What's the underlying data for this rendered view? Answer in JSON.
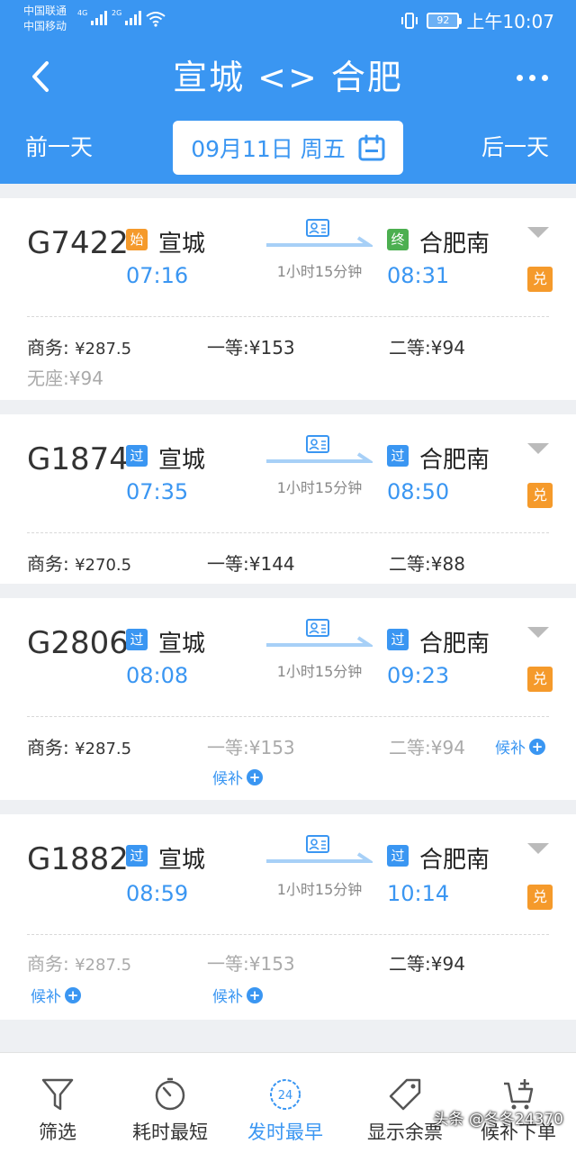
{
  "status_bar": {
    "carrier1": "中国联通",
    "carrier2": "中国移动",
    "net1": "4G",
    "net2": "2G",
    "battery": "92",
    "time": "上午10:07"
  },
  "header": {
    "title": "宣城 <> 合肥",
    "prev_day": "前一天",
    "next_day": "后一天",
    "date": "09月11日 周五",
    "bg_color": "#3a96f2"
  },
  "trains": [
    {
      "number": "G7422",
      "from_tag": "始",
      "from_station": "宣城",
      "depart": "07:16",
      "duration": "1小时15分钟",
      "to_tag": "终",
      "to_station": "合肥南",
      "arrive": "08:31",
      "exchange": "兑",
      "prices": {
        "business_label": "商务:",
        "business": "¥287.5",
        "first_label": "一等:",
        "first": "¥153",
        "second_label": "二等:",
        "second": "¥94",
        "noseat_label": "无座:",
        "noseat": "¥94"
      }
    },
    {
      "number": "G1874",
      "from_tag": "过",
      "from_station": "宣城",
      "depart": "07:35",
      "duration": "1小时15分钟",
      "to_tag": "过",
      "to_station": "合肥南",
      "arrive": "08:50",
      "exchange": "兑",
      "prices": {
        "business_label": "商务:",
        "business": "¥270.5",
        "first_label": "一等:",
        "first": "¥144",
        "second_label": "二等:",
        "second": "¥88"
      }
    },
    {
      "number": "G2806",
      "from_tag": "过",
      "from_station": "宣城",
      "depart": "08:08",
      "duration": "1小时15分钟",
      "to_tag": "过",
      "to_station": "合肥南",
      "arrive": "09:23",
      "exchange": "兑",
      "prices": {
        "business_label": "商务:",
        "business": "¥287.5",
        "first_label": "一等:",
        "first": "¥153",
        "second_label": "二等:",
        "second": "¥94"
      },
      "waitlist": "候补"
    },
    {
      "number": "G1882",
      "from_tag": "过",
      "from_station": "宣城",
      "depart": "08:59",
      "duration": "1小时15分钟",
      "to_tag": "过",
      "to_station": "合肥南",
      "arrive": "10:14",
      "exchange": "兑",
      "prices": {
        "business_label": "商务:",
        "business": "¥287.5",
        "first_label": "一等:",
        "first": "¥153",
        "second_label": "二等:",
        "second": "¥94"
      },
      "waitlist": "候补"
    }
  ],
  "bottom_tabs": [
    {
      "label": "筛选",
      "icon": "filter-icon"
    },
    {
      "label": "耗时最短",
      "icon": "timer-icon"
    },
    {
      "label": "发时最早",
      "icon": "clock-24-icon",
      "badge": "24",
      "active": true
    },
    {
      "label": "显示余票",
      "icon": "ticket-tag-icon"
    },
    {
      "label": "候补下单",
      "icon": "cart-add-icon"
    }
  ],
  "watermark": "头条 @冬冬24370"
}
